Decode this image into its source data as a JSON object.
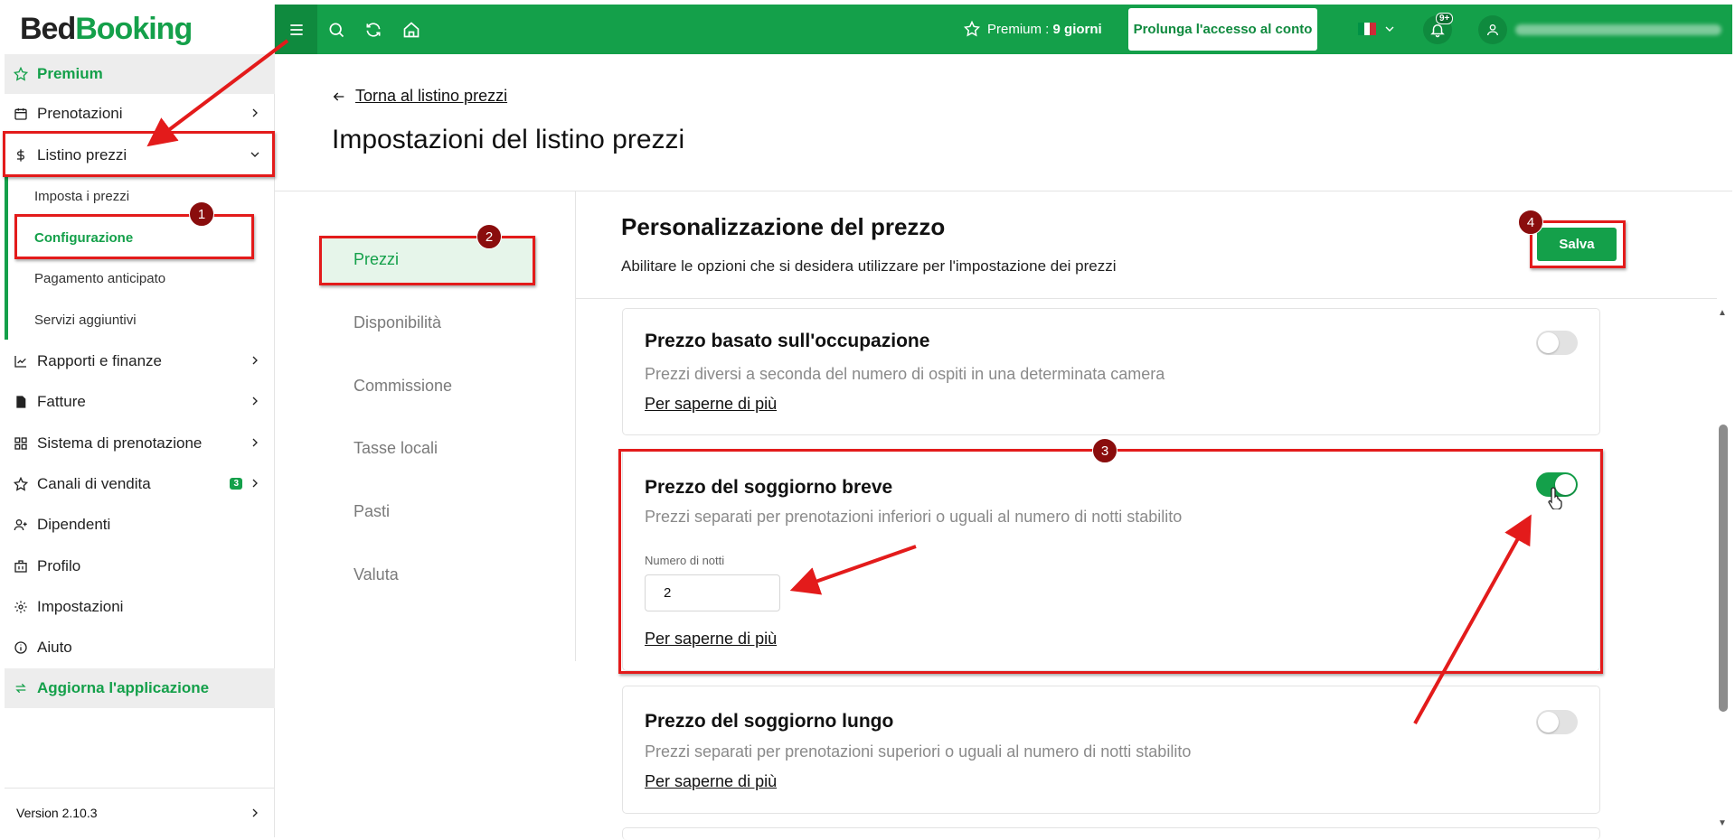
{
  "logo": {
    "part1": "Bed",
    "part2": "Booking"
  },
  "sidebar": {
    "premium": "Premium",
    "items": [
      {
        "label": "Prenotazioni",
        "icon": "calendar-icon"
      },
      {
        "label": "Listino prezzi",
        "icon": "dollar-icon"
      },
      {
        "label": "Rapporti e finanze",
        "icon": "chart-icon"
      },
      {
        "label": "Fatture",
        "icon": "invoice-icon"
      },
      {
        "label": "Sistema di prenotazione",
        "icon": "grid-icon"
      },
      {
        "label": "Canali di vendita",
        "icon": "star-icon",
        "badge": "3"
      },
      {
        "label": "Dipendenti",
        "icon": "user-add-icon"
      },
      {
        "label": "Profilo",
        "icon": "building-icon"
      },
      {
        "label": "Impostazioni",
        "icon": "gear-icon"
      },
      {
        "label": "Aiuto",
        "icon": "info-icon"
      }
    ],
    "subitems": [
      "Imposta i prezzi",
      "Configurazione",
      "Pagamento anticipato",
      "Servizi aggiuntivi"
    ],
    "update_app": "Aggiorna l'applicazione",
    "version": "Version 2.10.3"
  },
  "topbar": {
    "premium_label": "Premium : ",
    "premium_days": "9 giorni",
    "extend_button": "Prolunga l'accesso al conto",
    "notifications_badge": "9+"
  },
  "header": {
    "back_link": "Torna al listino prezzi",
    "title": "Impostazioni del listino prezzi"
  },
  "settings_nav": [
    "Prezzi",
    "Disponibilità",
    "Commissione",
    "Tasse locali",
    "Pasti",
    "Valuta"
  ],
  "content": {
    "title": "Personalizzazione del prezzo",
    "subtitle": "Abilitare le opzioni che si desidera utilizzare per l'impostazione dei prezzi",
    "save_button": "Salva",
    "cards": [
      {
        "title": "Prezzo basato sull'occupazione",
        "desc": "Prezzi diversi a seconda del numero di ospiti in una determinata camera",
        "link": "Per saperne di più",
        "enabled": false
      },
      {
        "title": "Prezzo del soggiorno breve",
        "desc": "Prezzi separati per prenotazioni inferiori o uguali al numero di notti stabilito",
        "field_label": "Numero di notti",
        "field_value": "2",
        "link": "Per saperne di più",
        "enabled": true
      },
      {
        "title": "Prezzo del soggiorno lungo",
        "desc": "Prezzi separati per prenotazioni superiori o uguali al numero di notti stabilito",
        "link": "Per saperne di più",
        "enabled": false
      }
    ]
  },
  "annotations": [
    "1",
    "2",
    "3",
    "4"
  ],
  "colors": {
    "brand": "#14a04a",
    "brand_dark": "#0f8a3e",
    "annotation": "#e31b1b",
    "annotation_badge": "#8a0d0d"
  }
}
